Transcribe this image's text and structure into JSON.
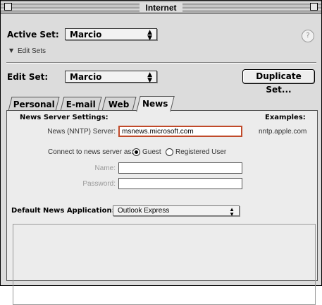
{
  "window": {
    "title": "Internet"
  },
  "active_set": {
    "label": "Active Set:",
    "value": "Marcio"
  },
  "edit_sets_link": {
    "label": "Edit Sets"
  },
  "edit_set": {
    "label": "Edit Set:",
    "value": "Marcio"
  },
  "duplicate_button": {
    "label": "Duplicate Set..."
  },
  "tabs": [
    {
      "label": "Personal"
    },
    {
      "label": "E-mail"
    },
    {
      "label": "Web"
    },
    {
      "label": "News"
    }
  ],
  "news": {
    "section_title": "News Server Settings:",
    "examples_title": "Examples:",
    "server_label": "News (NNTP) Server:",
    "server_value": "msnews.microsoft.com",
    "server_example": "nntp.apple.com",
    "connect_label": "Connect to news server as:",
    "guest_label": "Guest",
    "registered_label": "Registered User",
    "name_label": "Name:",
    "password_label": "Password:",
    "name_value": "",
    "password_value": ""
  },
  "default_app": {
    "label": "Default News Application:",
    "value": "Outlook Express"
  },
  "colors": {
    "focus_ring": "#c04a2a",
    "window_bg": "#dcdcdc",
    "panel_bg": "#ececec"
  }
}
